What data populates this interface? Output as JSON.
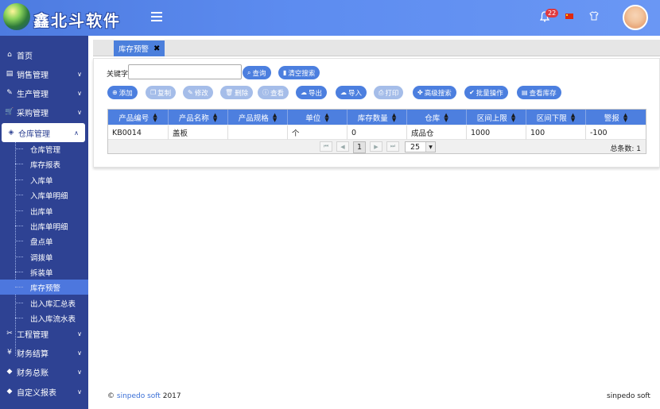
{
  "app": {
    "logo_text": "鑫北斗软件",
    "notification_count": "22",
    "colors": {
      "header": "#5d8cf0",
      "sidebar": "#2e4293",
      "accent": "#4c7fdf",
      "badge": "#e0393e"
    }
  },
  "sidebar": {
    "items": [
      {
        "label": "首页",
        "icon": "home-icon",
        "glyph": "⌂"
      },
      {
        "label": "销售管理",
        "icon": "sales-icon",
        "glyph": "▤"
      },
      {
        "label": "生产管理",
        "icon": "wrench-icon",
        "glyph": "✎"
      },
      {
        "label": "采购管理",
        "icon": "cart-icon",
        "glyph": "🛒"
      },
      {
        "label": "仓库管理",
        "icon": "cube-icon",
        "glyph": "◈"
      },
      {
        "label": "工程管理",
        "icon": "tools-icon",
        "glyph": "✂"
      },
      {
        "label": "财务结算",
        "icon": "yen-icon",
        "glyph": "¥"
      },
      {
        "label": "财务总账",
        "icon": "tag-icon",
        "glyph": "◆"
      },
      {
        "label": "自定义报表",
        "icon": "tag-icon",
        "glyph": "◆"
      }
    ],
    "warehouse_sub": [
      "仓库管理",
      "库存报表",
      "入库单",
      "入库单明细",
      "出库单",
      "出库单明细",
      "盘点单",
      "调拨单",
      "拆装单",
      "库存预警",
      "出入库汇总表",
      "出入库流水表"
    ]
  },
  "tab": {
    "label": "库存预警",
    "close": "✖"
  },
  "search": {
    "label": "关键字",
    "value": "",
    "query_btn": "查询",
    "clear_btn": "清空搜索"
  },
  "toolbar": [
    {
      "label": "添加",
      "icon": "plus-circle-icon",
      "glyph": "⊕",
      "dim": false
    },
    {
      "label": "复制",
      "icon": "copy-icon",
      "glyph": "❐",
      "dim": true
    },
    {
      "label": "修改",
      "icon": "pencil-icon",
      "glyph": "✎",
      "dim": true
    },
    {
      "label": "删除",
      "icon": "trash-icon",
      "glyph": "🗑",
      "dim": true
    },
    {
      "label": "查看",
      "icon": "info-icon",
      "glyph": "ⓘ",
      "dim": true
    },
    {
      "label": "导出",
      "icon": "cloud-download-icon",
      "glyph": "☁",
      "dim": false
    },
    {
      "label": "导入",
      "icon": "cloud-upload-icon",
      "glyph": "☁",
      "dim": false
    },
    {
      "label": "打印",
      "icon": "print-icon",
      "glyph": "⎙",
      "dim": true
    },
    {
      "label": "高级搜索",
      "icon": "paw-icon",
      "glyph": "✤",
      "dim": false
    },
    {
      "label": "批量操作",
      "icon": "check-circle-icon",
      "glyph": "✔",
      "dim": false
    },
    {
      "label": "查看库存",
      "icon": "list-icon",
      "glyph": "▤",
      "dim": false
    }
  ],
  "table": {
    "columns": [
      "产品编号",
      "产品名称",
      "产品规格",
      "单位",
      "库存数量",
      "仓库",
      "区间上限",
      "区间下限",
      "警报"
    ],
    "rows": [
      [
        "KB0014",
        "盖板",
        "",
        "个",
        "0",
        "成品仓",
        "1000",
        "100",
        "-100"
      ]
    ],
    "pager": {
      "current_page": "1",
      "page_size": "25",
      "total": "总条数: 1"
    }
  },
  "footer": {
    "copyright": "©",
    "company_link": "sinpedo soft",
    "year": "2017",
    "right": "sinpedo soft"
  }
}
